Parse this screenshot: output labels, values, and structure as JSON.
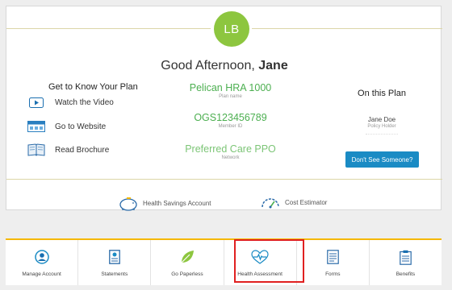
{
  "avatar": {
    "initials": "LB",
    "color": "#8dc63f"
  },
  "greeting": {
    "prefix": "Good Afternoon,",
    "name": "Jane"
  },
  "know_plan": {
    "title": "Get to Know Your Plan",
    "links": [
      {
        "label": "Watch the Video",
        "icon": "play-video-icon"
      },
      {
        "label": "Go to Website",
        "icon": "website-icon"
      },
      {
        "label": "Read Brochure",
        "icon": "brochure-icon"
      }
    ]
  },
  "plan": {
    "plan_name": "Pelican HRA 1000",
    "plan_name_label": "Plan name",
    "member_id": "OGS123456789",
    "member_id_label": "Member ID",
    "network": "Preferred Care PPO",
    "network_label": "Network"
  },
  "on_plan": {
    "title": "On this Plan",
    "name": "Jane Doe",
    "role": "Policy Holder",
    "button": "Don't See Someone?"
  },
  "tools": [
    {
      "label": "Health Savings Account",
      "icon": "piggy-bank-icon"
    },
    {
      "label": "Cost Estimator",
      "icon": "gauge-icon"
    }
  ],
  "nav": [
    {
      "label": "Manage Account",
      "icon": "account-icon"
    },
    {
      "label": "Statements",
      "icon": "statements-icon"
    },
    {
      "label": "Go Paperless",
      "icon": "leaf-icon"
    },
    {
      "label": "Health Assessment",
      "icon": "heart-pulse-icon"
    },
    {
      "label": "Forms",
      "icon": "forms-icon"
    },
    {
      "label": "Benefits",
      "icon": "clipboard-icon"
    }
  ],
  "colors": {
    "green": "#4caf50",
    "blue": "#1a8bc4",
    "yellow": "#f5b800",
    "highlight": "#e02020"
  }
}
